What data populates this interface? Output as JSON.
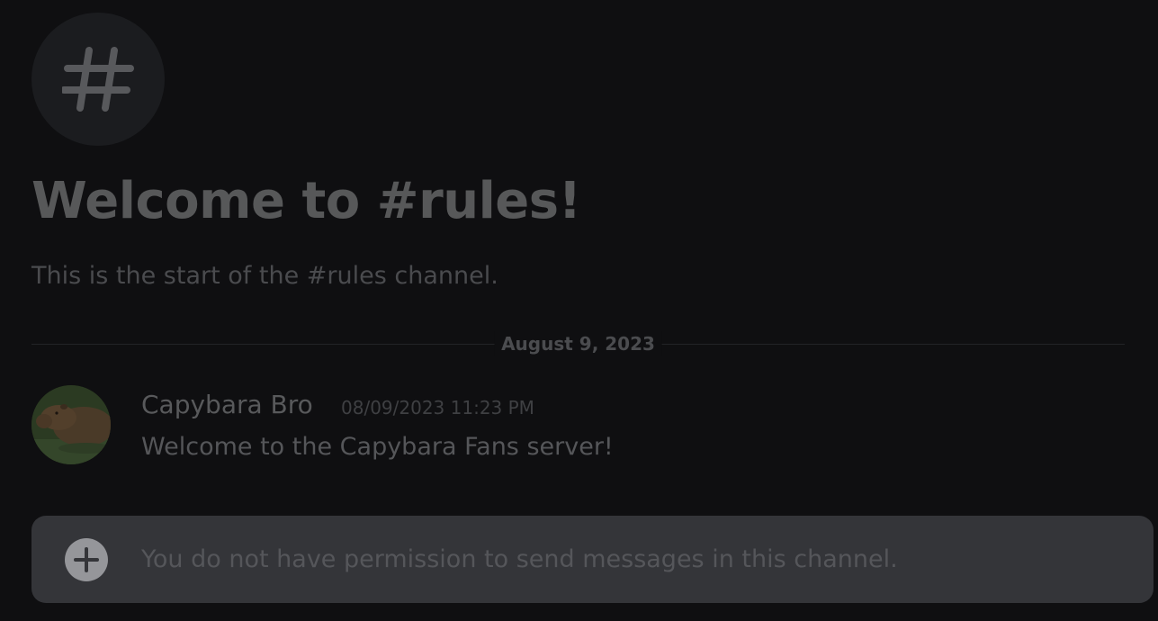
{
  "channel": {
    "icon": "hash-icon",
    "welcome_title": "Welcome to #rules!",
    "welcome_subtitle": "This is the start of the #rules channel."
  },
  "divider": {
    "date": "August 9, 2023"
  },
  "messages": [
    {
      "author": "Capybara Bro",
      "timestamp": "08/09/2023 11:23 PM",
      "text": "Welcome to the Capybara Fans server!",
      "avatar": "capybara-avatar"
    }
  ],
  "composer": {
    "placeholder": "You do not have permission to send messages in this channel.",
    "add_icon": "plus-circle-icon"
  },
  "colors": {
    "background": "#0f0f11",
    "composer": "#343539",
    "icon_circle": "#1b1c1f"
  }
}
